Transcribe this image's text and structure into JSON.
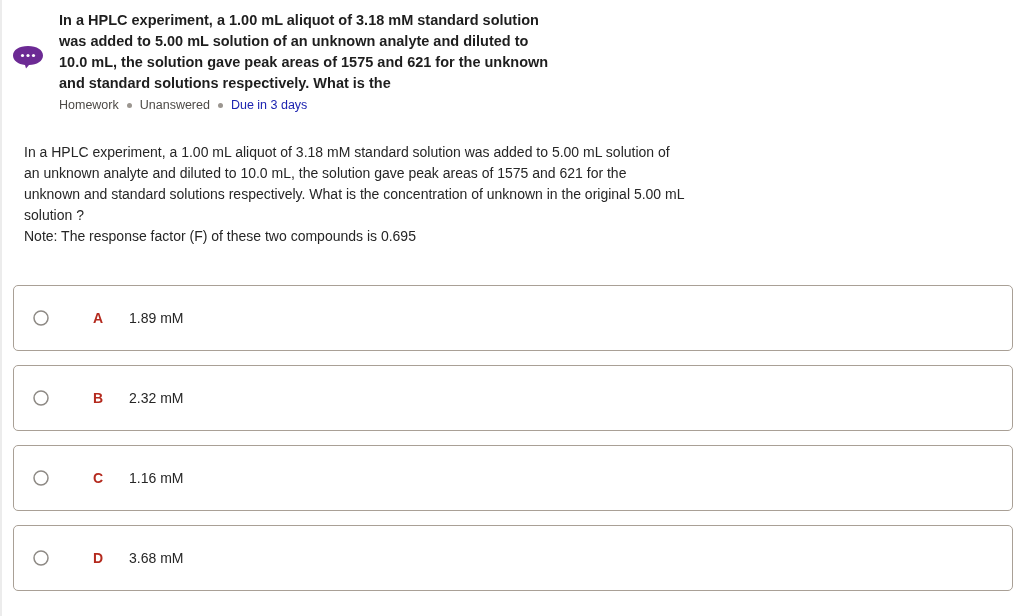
{
  "question_header": {
    "title": "In a HPLC experiment, a 1.00 mL aliquot of 3.18 mM standard solution was added to 5.00 mL solution of an unknown analyte and diluted to 10.0 mL, the solution gave peak areas of 1575 and 621 for the unknown and standard solutions respectively. What is the",
    "meta": [
      {
        "text": "Homework",
        "kind": "plain"
      },
      {
        "text": "Unanswered",
        "kind": "plain"
      },
      {
        "text": "Due in 3 days",
        "kind": "link"
      }
    ]
  },
  "question_body": {
    "paragraphs": [
      "In a HPLC experiment, a 1.00 mL aliquot of 3.18 mM standard solution was added to 5.00 mL solution of an unknown analyte and diluted to 10.0 mL, the solution gave peak areas of 1575 and 621 for the unknown and standard solutions respectively. What is the concentration of unknown in the original 5.00 mL solution ?",
      "Note: The response factor (F) of these two compounds is 0.695"
    ]
  },
  "options": [
    {
      "letter": "A",
      "value": "1.89 mM",
      "selected": false
    },
    {
      "letter": "B",
      "value": "2.32 mM",
      "selected": false
    },
    {
      "letter": "C",
      "value": "1.16 mM",
      "selected": false
    },
    {
      "letter": "D",
      "value": "3.68 mM",
      "selected": false
    }
  ]
}
